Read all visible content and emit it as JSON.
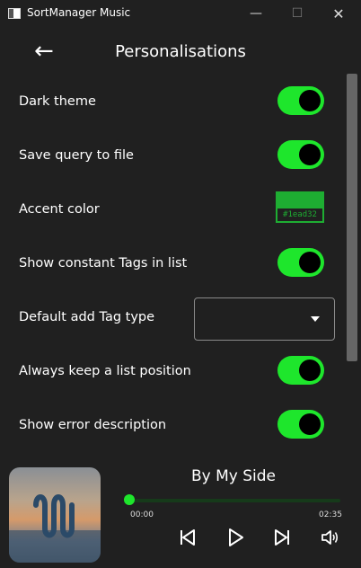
{
  "window": {
    "title": "SortManager Music",
    "minimize": "—",
    "maximize": "☐",
    "close": "✕"
  },
  "header": {
    "back": "←",
    "title": "Personalisations"
  },
  "settings": [
    {
      "label": "Dark theme",
      "control": "toggle",
      "on": true
    },
    {
      "label": "Save query to file",
      "control": "toggle",
      "on": true
    },
    {
      "label": "Accent color",
      "control": "color",
      "value": "#1ead32"
    },
    {
      "label": "Show constant Tags in list",
      "control": "toggle",
      "on": true
    },
    {
      "label": "Default add Tag type",
      "control": "dropdown",
      "value": ""
    },
    {
      "label": "Always keep a list position",
      "control": "toggle",
      "on": true
    },
    {
      "label": "Show error description",
      "control": "toggle",
      "on": true
    }
  ],
  "player": {
    "song_title": "By My Side",
    "current_time": "00:00",
    "total_time": "02:35",
    "progress": 0
  },
  "colors": {
    "accent": "#1ead32",
    "toggle_on": "#1ee62c",
    "background": "#202020"
  }
}
